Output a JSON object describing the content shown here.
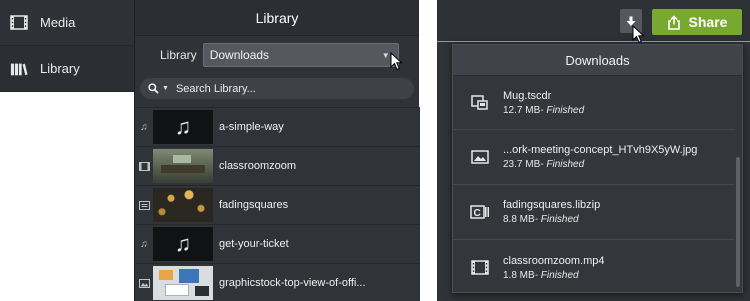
{
  "sidebar": {
    "items": [
      {
        "label": "Media",
        "icon": "film-strip-icon"
      },
      {
        "label": "Library",
        "icon": "books-icon"
      }
    ]
  },
  "library": {
    "title": "Library",
    "select_label": "Library",
    "select_value": "Downloads",
    "search_placeholder": "Search Library...",
    "assets": [
      {
        "name": "a-simple-way",
        "type_icon": "music-note-icon"
      },
      {
        "name": "classroomzoom",
        "type_icon": "film-strip-icon"
      },
      {
        "name": "fadingsquares",
        "type_icon": "caption-icon"
      },
      {
        "name": "get-your-ticket",
        "type_icon": "music-note-icon"
      },
      {
        "name": "graphicstock-top-view-of-offi...",
        "type_icon": "image-icon"
      }
    ]
  },
  "topbar": {
    "share_label": "Share",
    "download_icon": "download-arrow-icon"
  },
  "downloads": {
    "title": "Downloads",
    "items": [
      {
        "name": "Mug.tscdr",
        "size": "12.7 MB",
        "status": "- Finished",
        "icon": "device-file-icon"
      },
      {
        "name": "...ork-meeting-concept_HTvh9X5yW.jpg",
        "size": "23.7 MB",
        "status": "- Finished",
        "icon": "image-icon"
      },
      {
        "name": "fadingsquares.libzip",
        "size": "8.8 MB",
        "status": "- Finished",
        "icon": "library-zip-icon"
      },
      {
        "name": "classroomzoom.mp4",
        "size": "1.8 MB",
        "status": "- Finished",
        "icon": "film-strip-icon"
      }
    ]
  },
  "colors": {
    "panel": "#2f3236",
    "share_green": "#79a830",
    "accent_line": "#8ab33a"
  }
}
